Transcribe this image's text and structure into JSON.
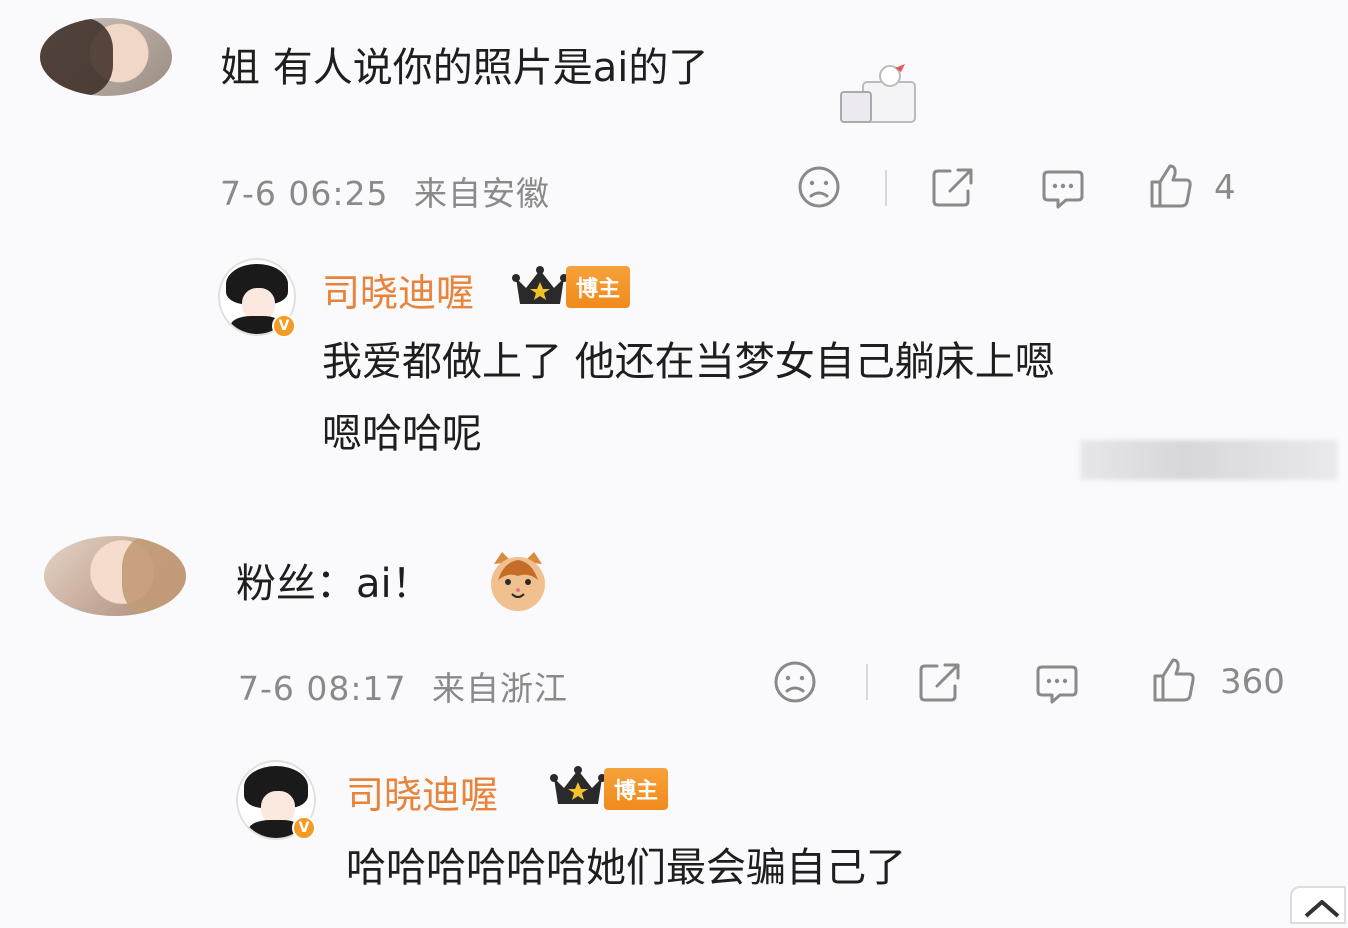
{
  "comments": [
    {
      "text": "姐 有人说你的照片是ai的了",
      "time": "7-6 06:25",
      "location": "来自安徽",
      "likes": "4",
      "reply": {
        "username": "司晓迪喔",
        "badge": "博主",
        "verified": "V",
        "line1": "我爱都做上了 他还在当梦女自己躺床上嗯",
        "line2": "嗯哈哈呢"
      }
    },
    {
      "text": "粉丝：ai！",
      "time": "7-6 08:17",
      "location": "来自浙江",
      "likes": "360",
      "reply": {
        "username": "司晓迪喔",
        "badge": "博主",
        "verified": "V",
        "line1": "哈哈哈哈哈哈她们最会骗自己了"
      }
    }
  ],
  "icons": [
    "dislike-face-icon",
    "share-icon",
    "comment-bubble-icon",
    "thumbs-up-icon",
    "crown-icon",
    "cat-sticker-icon"
  ]
}
